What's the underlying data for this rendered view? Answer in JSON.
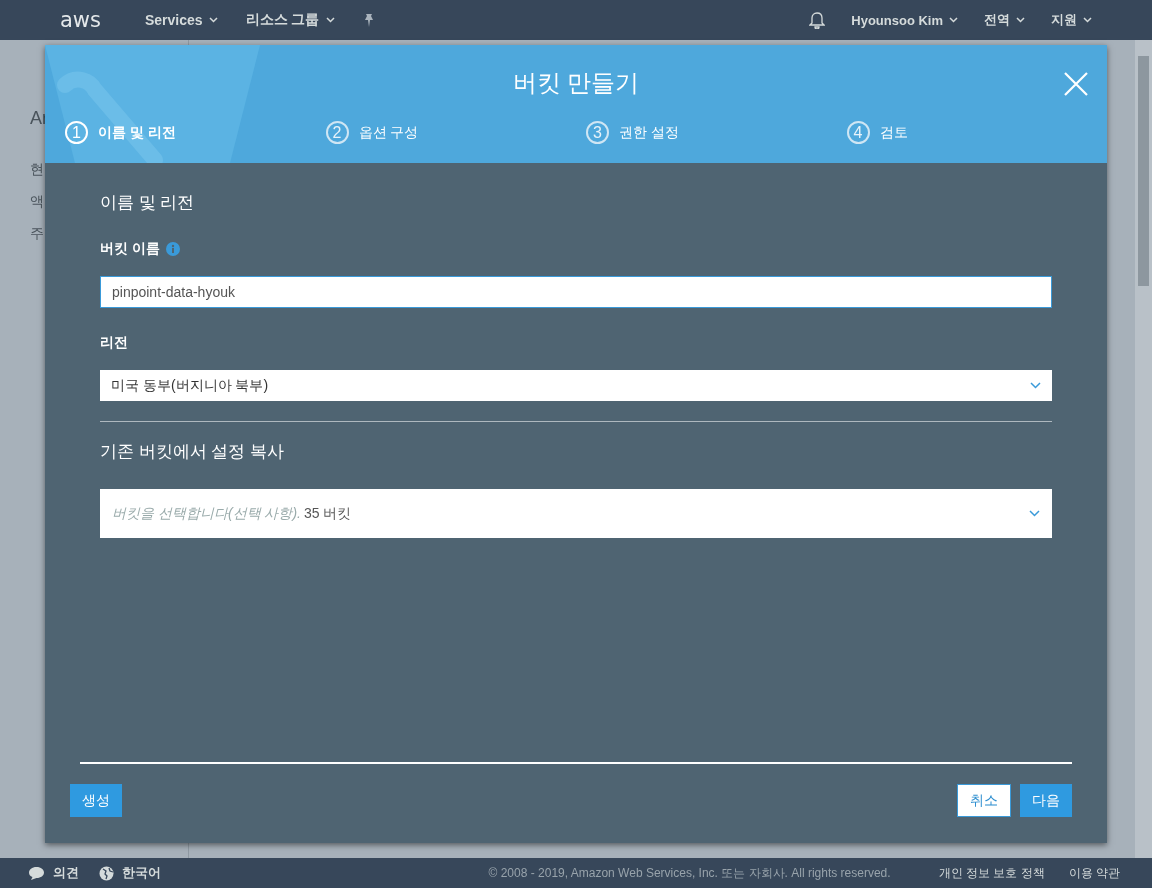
{
  "top_nav": {
    "logo": "aws",
    "menus": [
      {
        "label": "Services"
      },
      {
        "label": "리소스 그룹"
      }
    ],
    "user": "Hyounsoo Kim",
    "region": "전역",
    "support": "지원"
  },
  "background_page": {
    "title": "Ar",
    "sidebar_texts": [
      "현",
      "액",
      "주"
    ]
  },
  "modal": {
    "title": "버킷 만들기",
    "steps": [
      {
        "number": "1",
        "label": "이름 및 리전",
        "selected": true
      },
      {
        "number": "2",
        "label": "옵션 구성",
        "selected": false
      },
      {
        "number": "3",
        "label": "권한 설정",
        "selected": false
      },
      {
        "number": "4",
        "label": "검토",
        "selected": false
      }
    ],
    "section_title": "이름 및 리전",
    "bucket_name": {
      "label": "버킷 이름",
      "value": "pinpoint-data-hyouk"
    },
    "region": {
      "label": "리전",
      "value": "미국 동부(버지니아 북부)"
    },
    "copy_section_title": "기존 버킷에서 설정 복사",
    "copy_select": {
      "placeholder": "버킷을 선택합니다(선택 사항).",
      "count": "35 버킷"
    },
    "buttons": {
      "create": "생성",
      "cancel": "취소",
      "next": "다음"
    }
  },
  "footer": {
    "feedback": "의견",
    "language": "한국어",
    "copyright": "© 2008 - 2019, Amazon Web Services, Inc. 또는 자회사. All rights reserved.",
    "links": [
      "개인 정보 보호 정책",
      "이용 약관"
    ]
  }
}
